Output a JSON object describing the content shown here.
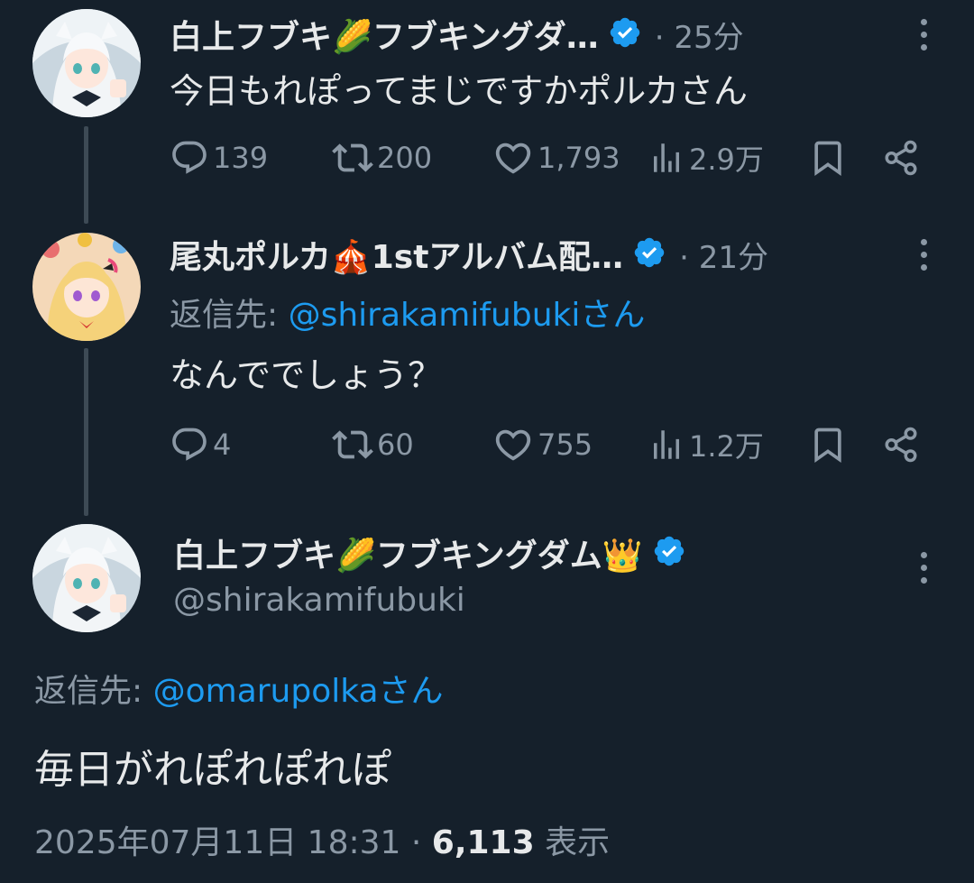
{
  "tweets": [
    {
      "name": "白上フブキ🌽フブキングダ…",
      "time": "25分",
      "text": "今日もれぽってまじですかポルカさん",
      "replies": "139",
      "retweets": "200",
      "likes": "1,793",
      "views": "2.9万"
    },
    {
      "name": "尾丸ポルカ🎪1stアルバム配…",
      "time": "21分",
      "reply_label": "返信先:",
      "reply_mention": "@shirakamifubukiさん",
      "text": "なんででしょう？",
      "replies": "4",
      "retweets": "60",
      "likes": "755",
      "views": "1.2万"
    }
  ],
  "main": {
    "name": "白上フブキ🌽フブキングダム👑",
    "handle": "@shirakamifubuki",
    "reply_label": "返信先:",
    "reply_mention": "@omarupolkaさん",
    "text": "毎日がれぽれぽれぽ",
    "datetime": "2025年07月11日 18:31",
    "views_count": "6,113",
    "views_label": "表示"
  },
  "colors": {
    "background": "#15202b",
    "text": "#e7e9ea",
    "secondary": "#8b98a5",
    "accent": "#1d9bf0"
  }
}
